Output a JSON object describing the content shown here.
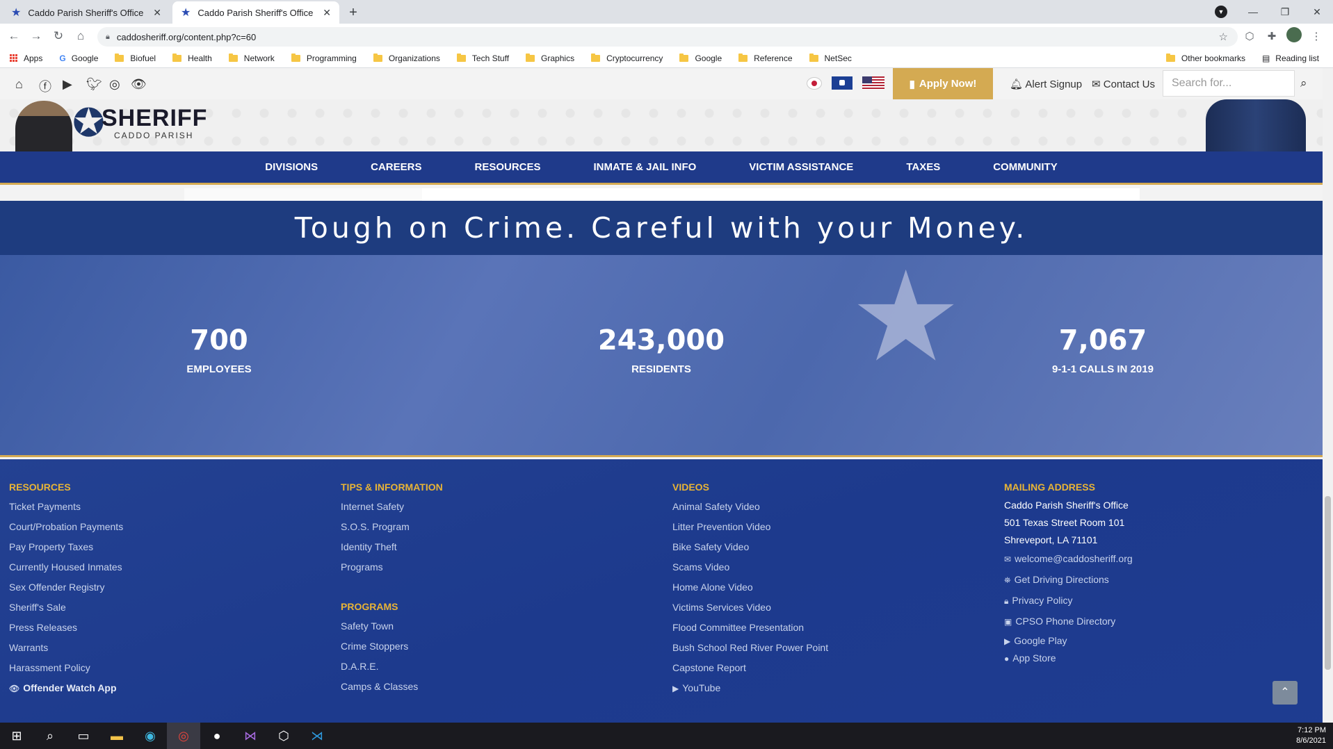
{
  "browser": {
    "tabs": [
      {
        "title": "Caddo Parish Sheriff's Office"
      },
      {
        "title": "Caddo Parish Sheriff's Office"
      }
    ],
    "url": "caddosheriff.org/content.php?c=60",
    "bookmarks": [
      "Apps",
      "Google",
      "Biofuel",
      "Health",
      "Network",
      "Programming",
      "Organizations",
      "Tech Stuff",
      "Graphics",
      "Cryptocurrency",
      "Google",
      "Reference",
      "NetSec"
    ],
    "other_bookmarks": "Other bookmarks",
    "reading_list": "Reading list"
  },
  "util": {
    "apply": "Apply Now!",
    "alert": "Alert Signup",
    "contact": "Contact Us",
    "search_placeholder": "Search for..."
  },
  "logo": {
    "title": "SHERIFF",
    "subtitle": "CADDO PARISH"
  },
  "nav": [
    "DIVISIONS",
    "CAREERS",
    "RESOURCES",
    "INMATE & JAIL INFO",
    "VICTIM ASSISTANCE",
    "TAXES",
    "COMMUNITY"
  ],
  "tagline": "Tough on Crime. Careful with your Money.",
  "stats": [
    {
      "value": "700",
      "label": "EMPLOYEES"
    },
    {
      "value": "243,000",
      "label": "RESIDENTS"
    },
    {
      "value": "7,067",
      "label": "9-1-1 CALLS IN 2019"
    }
  ],
  "footer": {
    "resources": {
      "heading": "RESOURCES",
      "links": [
        "Ticket Payments",
        "Court/Probation Payments",
        "Pay Property Taxes",
        "Currently Housed Inmates",
        "Sex Offender Registry",
        "Sheriff's Sale",
        "Press Releases",
        "Warrants",
        "Harassment Policy"
      ],
      "app": "Offender Watch App"
    },
    "tips": {
      "heading": "TIPS & INFORMATION",
      "links": [
        "Internet Safety",
        "S.O.S. Program",
        "Identity Theft",
        "Programs"
      ]
    },
    "programs": {
      "heading": "PROGRAMS",
      "links": [
        "Safety Town",
        "Crime Stoppers",
        "D.A.R.E.",
        "Camps & Classes"
      ]
    },
    "videos": {
      "heading": "VIDEOS",
      "links": [
        "Animal Safety Video",
        "Litter Prevention Video",
        "Bike Safety Video",
        "Scams Video",
        "Home Alone Video",
        "Victims Services Video",
        "Flood Committee Presentation",
        "Bush School Red River Power Point",
        "Capstone Report"
      ],
      "youtube": "YouTube"
    },
    "mailing": {
      "heading": "MAILING ADDRESS",
      "lines": [
        "Caddo Parish Sheriff's Office",
        "501 Texas Street Room 101",
        "Shreveport, LA 71101"
      ],
      "email": "welcome@caddosheriff.org",
      "directions": "Get Driving Directions",
      "privacy": "Privacy Policy",
      "phone_dir": "CPSO Phone Directory",
      "google_play": "Google Play",
      "app_store": "App Store"
    }
  },
  "taskbar": {
    "time": "7:12 PM",
    "date": "8/6/2021"
  },
  "colors": {
    "nav_blue": "#1f3a8a",
    "gold": "#d4aa52",
    "footer_heading": "#e8b436"
  }
}
